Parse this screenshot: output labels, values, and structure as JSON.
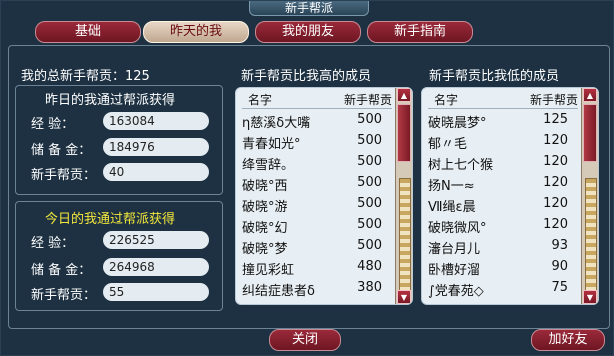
{
  "window": {
    "title": "新手帮派"
  },
  "tabs": [
    {
      "label": "基础"
    },
    {
      "label": "昨天的我"
    },
    {
      "label": "我的朋友"
    },
    {
      "label": "新手指南"
    }
  ],
  "summary": {
    "total_label": "我的总新手帮贡：125"
  },
  "yesterday": {
    "heading": "昨日的我通过帮派获得",
    "exp_label": "经    验：",
    "exp_value": "163084",
    "reserve_label": "储 备 金：",
    "reserve_value": "184976",
    "contrib_label": "新手帮贡：",
    "contrib_value": "40"
  },
  "today": {
    "heading": "今日的我通过帮派获得",
    "exp_label": "经    验：",
    "exp_value": "226525",
    "reserve_label": "储 备 金：",
    "reserve_value": "264968",
    "contrib_label": "新手帮贡：",
    "contrib_value": "55"
  },
  "higher_list": {
    "title": "新手帮贡比我高的成员",
    "col_name": "名字",
    "col_contrib": "新手帮贡",
    "rows": [
      {
        "name": "η慈溪δ大嘴",
        "value": "500"
      },
      {
        "name": "青春如光°",
        "value": "500"
      },
      {
        "name": "绛雪辞。",
        "value": "500"
      },
      {
        "name": "破晓°西",
        "value": "500"
      },
      {
        "name": "破晓°游",
        "value": "500"
      },
      {
        "name": "破晓°幻",
        "value": "500"
      },
      {
        "name": "破晓°梦",
        "value": "500"
      },
      {
        "name": "撞见彩虹",
        "value": "480"
      },
      {
        "name": "纠结症患者δ",
        "value": "380"
      }
    ]
  },
  "lower_list": {
    "title": "新手帮贡比我低的成员",
    "col_name": "名字",
    "col_contrib": "新手帮贡",
    "rows": [
      {
        "name": "破晓晨梦°",
        "value": "125"
      },
      {
        "name": "郁〃毛",
        "value": "120"
      },
      {
        "name": "树上七个猴",
        "value": "120"
      },
      {
        "name": "扬N一≈",
        "value": "120"
      },
      {
        "name": "Ⅶ绳ε晨",
        "value": "120"
      },
      {
        "name": "破晓微风°",
        "value": "120"
      },
      {
        "name": "瀋台月儿",
        "value": "93"
      },
      {
        "name": "卧槽好溜",
        "value": "90"
      },
      {
        "name": "∫党春苑◇",
        "value": "75"
      }
    ]
  },
  "buttons": {
    "close": "关闭",
    "add_friend": "加好友"
  }
}
